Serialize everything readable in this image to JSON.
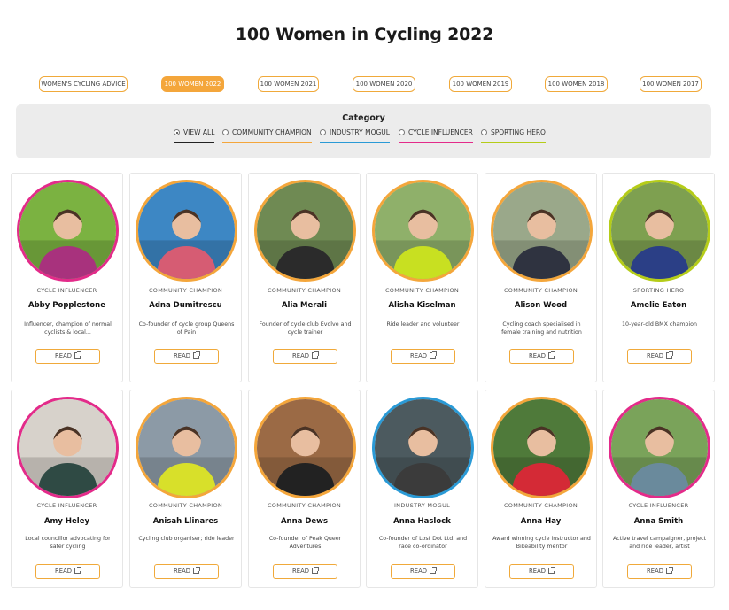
{
  "page": {
    "title": "100 Women in Cycling 2022"
  },
  "tabs": [
    {
      "label": "WOMEN'S CYCLING ADVICE",
      "active": false
    },
    {
      "label": "100 WOMEN 2022",
      "active": true
    },
    {
      "label": "100 WOMEN 2021",
      "active": false
    },
    {
      "label": "100 WOMEN 2020",
      "active": false
    },
    {
      "label": "100 WOMEN 2019",
      "active": false
    },
    {
      "label": "100 WOMEN 2018",
      "active": false
    },
    {
      "label": "100 WOMEN 2017",
      "active": false
    }
  ],
  "category": {
    "title": "Category",
    "filters": [
      {
        "label": "VIEW ALL",
        "selected": true,
        "color": "#222222"
      },
      {
        "label": "COMMUNITY CHAMPION",
        "selected": false,
        "color": "#f4a63b"
      },
      {
        "label": "INDUSTRY MOGUL",
        "selected": false,
        "color": "#2a9ad6"
      },
      {
        "label": "CYCLE INFLUENCER",
        "selected": false,
        "color": "#e32b8a"
      },
      {
        "label": "SPORTING HERO",
        "selected": false,
        "color": "#b5cc18"
      }
    ]
  },
  "colors": {
    "community": "#f4a63b",
    "industry": "#2a9ad6",
    "influencer": "#e32b8a",
    "sporting": "#b5cc18"
  },
  "read_label": "READ",
  "people": [
    {
      "name": "Abby Popplestone",
      "category": "CYCLE INFLUENCER",
      "ring": "#e32b8a",
      "desc": "Influencer, champion of normal cyclists & local...",
      "bg": "#7bb241",
      "shirt": "#a8327d"
    },
    {
      "name": "Adna Dumitrescu",
      "category": "COMMUNITY CHAMPION",
      "ring": "#f4a63b",
      "desc": "Co-founder of cycle group Queens of Pain",
      "bg": "#3d87c4",
      "shirt": "#d65c73"
    },
    {
      "name": "Alia Merali",
      "category": "COMMUNITY CHAMPION",
      "ring": "#f4a63b",
      "desc": "Founder of cycle club Evolve and cycle trainer",
      "bg": "#6f8a53",
      "shirt": "#2b2b2b"
    },
    {
      "name": "Alisha Kiselman",
      "category": "COMMUNITY CHAMPION",
      "ring": "#f4a63b",
      "desc": "Ride leader and volunteer",
      "bg": "#8fb06a",
      "shirt": "#c8e021"
    },
    {
      "name": "Alison Wood",
      "category": "COMMUNITY CHAMPION",
      "ring": "#f4a63b",
      "desc": "Cycling coach specialised in female training and nutrition",
      "bg": "#9aa88a",
      "shirt": "#2f3340"
    },
    {
      "name": "Amelie Eaton",
      "category": "SPORTING HERO",
      "ring": "#b5cc18",
      "desc": "10-year-old BMX champion",
      "bg": "#7ea050",
      "shirt": "#2b3f86"
    },
    {
      "name": "Amy Heley",
      "category": "CYCLE INFLUENCER",
      "ring": "#e32b8a",
      "desc": "Local councillor advocating for safer cycling",
      "bg": "#d7d2cb",
      "shirt": "#2f4a44"
    },
    {
      "name": "Anisah Llinares",
      "category": "COMMUNITY CHAMPION",
      "ring": "#f4a63b",
      "desc": "Cycling club organiser; ride leader",
      "bg": "#8c9aa6",
      "shirt": "#d8e02a"
    },
    {
      "name": "Anna Dews",
      "category": "COMMUNITY CHAMPION",
      "ring": "#f4a63b",
      "desc": "Co-founder of Peak Queer Adventures",
      "bg": "#9b6a45",
      "shirt": "#222222"
    },
    {
      "name": "Anna Haslock",
      "category": "INDUSTRY MOGUL",
      "ring": "#2a9ad6",
      "desc": "Co-founder of Lost Dot Ltd. and race co-ordinator",
      "bg": "#4c5a5f",
      "shirt": "#3b3b3b"
    },
    {
      "name": "Anna Hay",
      "category": "COMMUNITY CHAMPION",
      "ring": "#f4a63b",
      "desc": "Award winning cycle instructor and Bikeability mentor",
      "bg": "#4f7a3a",
      "shirt": "#d42a36"
    },
    {
      "name": "Anna Smith",
      "category": "CYCLE INFLUENCER",
      "ring": "#e32b8a",
      "desc": "Active travel campaigner, project and ride leader, artist",
      "bg": "#7aa35a",
      "shirt": "#6a8a9c"
    }
  ]
}
